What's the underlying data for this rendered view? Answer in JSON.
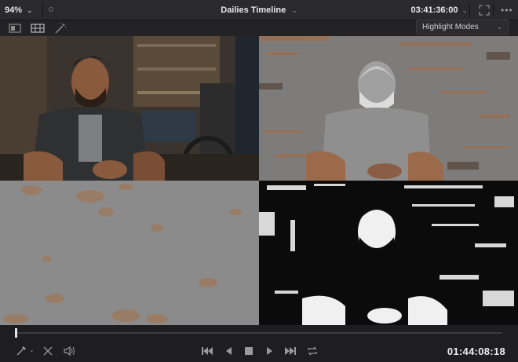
{
  "topbar": {
    "zoom_level": "94%",
    "title": "Dailies Timeline",
    "timecode": "03:41:36:00"
  },
  "toolbar": {
    "highlight_mode_label": "Highlight Modes"
  },
  "viewer": {
    "quadrants": [
      {
        "name": "original-image"
      },
      {
        "name": "highlight-difference-image"
      },
      {
        "name": "highlight-mask-color-image"
      },
      {
        "name": "highlight-bw-image"
      }
    ]
  },
  "scrubber": {
    "position": 0.0
  },
  "transport": {
    "timecode": "01:44:08:18"
  },
  "colors": {
    "background": "#1c1c1e",
    "topbar": "#2a2a2d",
    "accent_text": "#e6e6e6"
  }
}
